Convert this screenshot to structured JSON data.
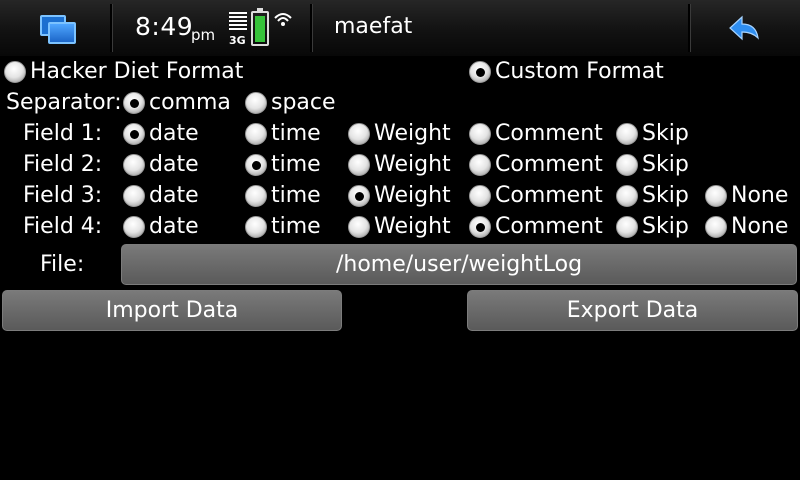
{
  "statusbar": {
    "time": "8:49",
    "ampm": "pm",
    "network": "3G",
    "app_title": "maefat",
    "battery_level": 0.85,
    "icons": {
      "tasks": "task-switcher-icon",
      "signal": "signal-strength-icon",
      "battery": "battery-icon",
      "wifi": "wifi-icon",
      "back": "back-arrow-icon"
    },
    "colors": {
      "accent": "#1c66c8",
      "battery_fill": "#36c23a"
    }
  },
  "format": {
    "options": [
      {
        "label": "Hacker Diet Format",
        "selected": false
      },
      {
        "label": "Custom Format",
        "selected": true
      }
    ]
  },
  "separator": {
    "label": "Separator:",
    "options": [
      {
        "label": "comma",
        "selected": true
      },
      {
        "label": "space",
        "selected": false
      }
    ]
  },
  "fields": [
    {
      "label": "Field 1:",
      "options": [
        {
          "label": "date",
          "selected": true
        },
        {
          "label": "time",
          "selected": false
        },
        {
          "label": "Weight",
          "selected": false
        },
        {
          "label": "Comment",
          "selected": false
        },
        {
          "label": "Skip",
          "selected": false
        }
      ]
    },
    {
      "label": "Field 2:",
      "options": [
        {
          "label": "date",
          "selected": false
        },
        {
          "label": "time",
          "selected": true
        },
        {
          "label": "Weight",
          "selected": false
        },
        {
          "label": "Comment",
          "selected": false
        },
        {
          "label": "Skip",
          "selected": false
        }
      ]
    },
    {
      "label": "Field 3:",
      "options": [
        {
          "label": "date",
          "selected": false
        },
        {
          "label": "time",
          "selected": false
        },
        {
          "label": "Weight",
          "selected": true
        },
        {
          "label": "Comment",
          "selected": false
        },
        {
          "label": "Skip",
          "selected": false
        },
        {
          "label": "None",
          "selected": false
        }
      ]
    },
    {
      "label": "Field 4:",
      "options": [
        {
          "label": "date",
          "selected": false
        },
        {
          "label": "time",
          "selected": false
        },
        {
          "label": "Weight",
          "selected": false
        },
        {
          "label": "Comment",
          "selected": true
        },
        {
          "label": "Skip",
          "selected": false
        },
        {
          "label": "None",
          "selected": false
        }
      ]
    }
  ],
  "file": {
    "label": "File:",
    "value": "/home/user/weightLog"
  },
  "buttons": {
    "import_label": "Import Data",
    "export_label": "Export Data"
  }
}
